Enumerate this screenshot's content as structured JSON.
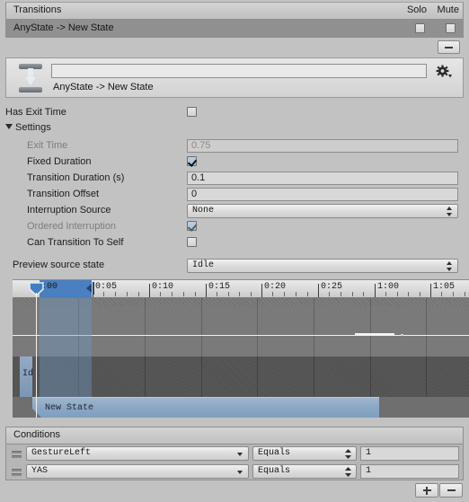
{
  "transitions_panel": {
    "title": "Transitions",
    "solo_label": "Solo",
    "mute_label": "Mute",
    "rows": [
      {
        "name": "AnyState -> New State",
        "solo": false,
        "mute": false
      }
    ],
    "remove_button_label": "–"
  },
  "transition_header": {
    "name_value": "",
    "name_placeholder": "",
    "subtitle": "AnyState -> New State",
    "settings_icon": "gear-icon",
    "transition_icon": "transition-icon"
  },
  "properties": {
    "has_exit_time": {
      "label": "Has Exit Time",
      "checked": false
    },
    "settings_foldout": {
      "label": "Settings",
      "expanded": true
    },
    "exit_time": {
      "label": "Exit Time",
      "value": "0.75",
      "disabled": true
    },
    "fixed_duration": {
      "label": "Fixed Duration",
      "checked": true
    },
    "transition_duration": {
      "label": "Transition Duration (s)",
      "value": "0.1"
    },
    "transition_offset": {
      "label": "Transition Offset",
      "value": "0"
    },
    "interruption_source": {
      "label": "Interruption Source",
      "value": "None"
    },
    "ordered_interruption": {
      "label": "Ordered Interruption",
      "checked": true,
      "disabled": true
    },
    "can_transition_to_self": {
      "label": "Can Transition To Self",
      "checked": false
    },
    "preview_source_state": {
      "label": "Preview source state",
      "value": "Idle"
    }
  },
  "timeline": {
    "tick_labels": [
      ":00",
      "0:05",
      "0:10",
      "0:15",
      "0:20",
      "0:25",
      "1:00",
      "1:05"
    ],
    "clips": [
      {
        "name": "Idle",
        "display": "Id"
      },
      {
        "name": "New State",
        "display": "New State"
      }
    ],
    "selection_start": ":00"
  },
  "conditions_panel": {
    "title": "Conditions",
    "rows": [
      {
        "parameter": "GestureLeft",
        "operator": "Equals",
        "value": "1"
      },
      {
        "parameter": "YAS",
        "operator": "Equals",
        "value": "1"
      }
    ],
    "add_label": "+",
    "remove_label": "–"
  },
  "colors": {
    "background": "#c2c2c2",
    "selection_blue": "#4a7fc1",
    "clip_blue": "#8aa6c4",
    "panel": "#b6b6b6"
  }
}
